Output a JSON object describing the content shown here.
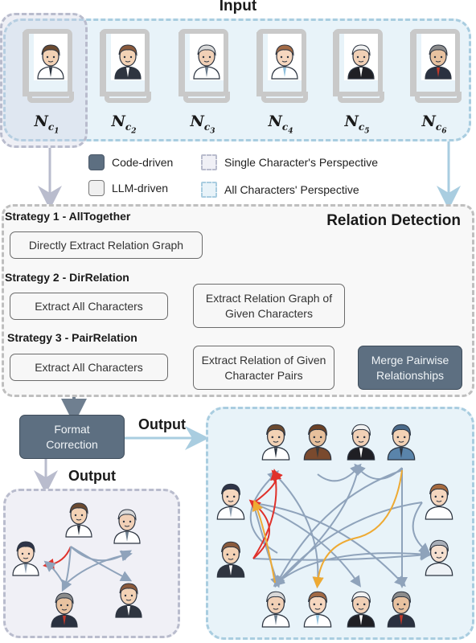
{
  "input": {
    "title": "Input",
    "books": [
      {
        "label": "N",
        "sub": "c1",
        "character": "male-doctor"
      },
      {
        "label": "N",
        "sub": "c2",
        "character": "female-businesswoman"
      },
      {
        "label": "N",
        "sub": "c3",
        "character": "elderly-doctor"
      },
      {
        "label": "N",
        "sub": "c4",
        "character": "female-doctor"
      },
      {
        "label": "N",
        "sub": "c5",
        "character": "elderly-priest"
      },
      {
        "label": "N",
        "sub": "c6",
        "character": "elderly-businessman"
      }
    ]
  },
  "legend": {
    "code_driven": "Code-driven",
    "llm_driven": "LLM-driven",
    "single_perspective": "Single Character's Perspective",
    "all_perspective": "All Characters' Perspective"
  },
  "relation_detection": {
    "title": "Relation Detection",
    "strategies": [
      {
        "name": "Strategy 1 - AllTogether",
        "steps": [
          "Directly Extract Relation Graph"
        ]
      },
      {
        "name": "Strategy 2 - DirRelation",
        "steps": [
          "Extract All Characters",
          "Extract Relation Graph of Given Characters"
        ]
      },
      {
        "name": "Strategy 3 - PairRelation",
        "steps": [
          "Extract All Characters",
          "Extract Relation of Given Character Pairs",
          "Merge Pairwise Relationships"
        ]
      }
    ]
  },
  "format_correction": {
    "label": "Format Correction"
  },
  "outputs": {
    "left_title": "Output",
    "right_title": "Output",
    "left_characters": [
      "male-doctor",
      "elderly-doctor",
      "young-doctor",
      "elderly-businessman",
      "female-businesswoman"
    ],
    "right_characters": [
      "male-doctor",
      "young-man-jacket",
      "elderly-priest",
      "police-officer",
      "young-doctor",
      "boy",
      "female-businesswoman",
      "elderly-woman",
      "elderly-doctor",
      "female-doctor",
      "elderly-priest-2",
      "elderly-businessman"
    ]
  },
  "colors": {
    "code_box": "#5d6f81",
    "llm_box": "#f7f7f7",
    "all_perspective": "#a9cde0",
    "single_perspective": "#b9bccd",
    "edge": "#8fa3bb",
    "edge_red": "#e0312b",
    "edge_orange": "#eeaa33"
  }
}
